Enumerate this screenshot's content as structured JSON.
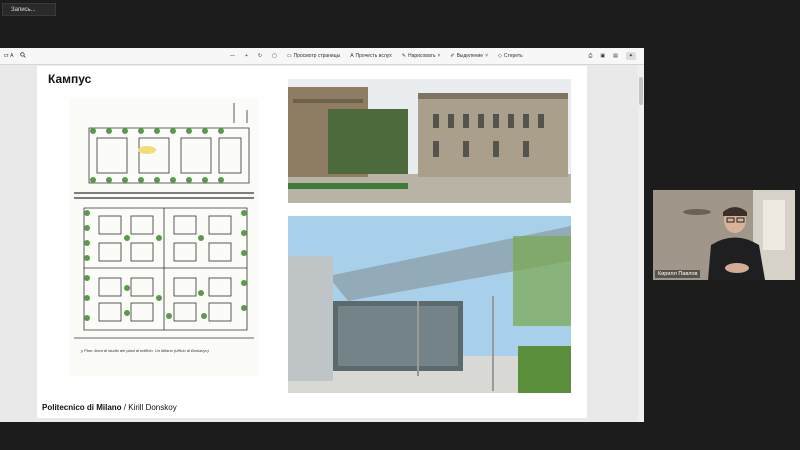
{
  "recording": {
    "label": "Запись..."
  },
  "viewer": {
    "zoom": "ст А",
    "search_icon": "search-icon",
    "toolbar": {
      "view_page": "Просмотр страницы",
      "read_aloud": "Прочесть вслух",
      "draw": "Нарисовать",
      "highlight": "Выделение",
      "erase": "Стереть"
    }
  },
  "slide": {
    "title": "Кампус",
    "footer_bold": "Politecnico di Milano",
    "footer_sep": " / ",
    "footer_author": "Kirill Donskoy",
    "sketch_caption": "y Plan: linea di studio dei piani di edificio. Un Milano (ufficio di Bonlavyo)"
  },
  "participant": {
    "name": "Кирилл Павлов"
  }
}
